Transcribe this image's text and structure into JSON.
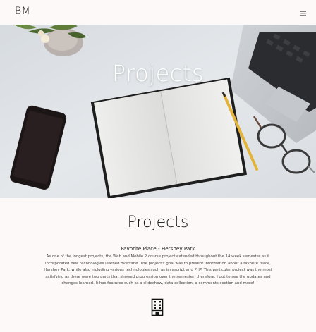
{
  "navbar": {
    "brand": "BM",
    "menu_icon": "hamburger-menu-icon"
  },
  "hero": {
    "title": "Projects",
    "image": "desk-workspace-photo"
  },
  "projects_section": {
    "heading": "Projects",
    "items": [
      {
        "title": "Favorite Place - Hershey Park",
        "description": "As one of the longest projects, the Web and Mobile 2 course project extended throughout the 14 week semester as it incorporated new technologies learned overtime. The project's goal was to present information about a favorite place, Hershey Park, while also including various technologies such as javascript and PHP. This particular project was the most satisfying as there were two parts that showed progression over the semester; therefore, I got to see the updates and changes learned. It has features such as a slideshow, data collection, a comments section and more!",
        "icon": "building-icon"
      }
    ]
  },
  "colors": {
    "background": "#fcf9f8",
    "hero_text": "#ffffff",
    "text": "#111111"
  }
}
